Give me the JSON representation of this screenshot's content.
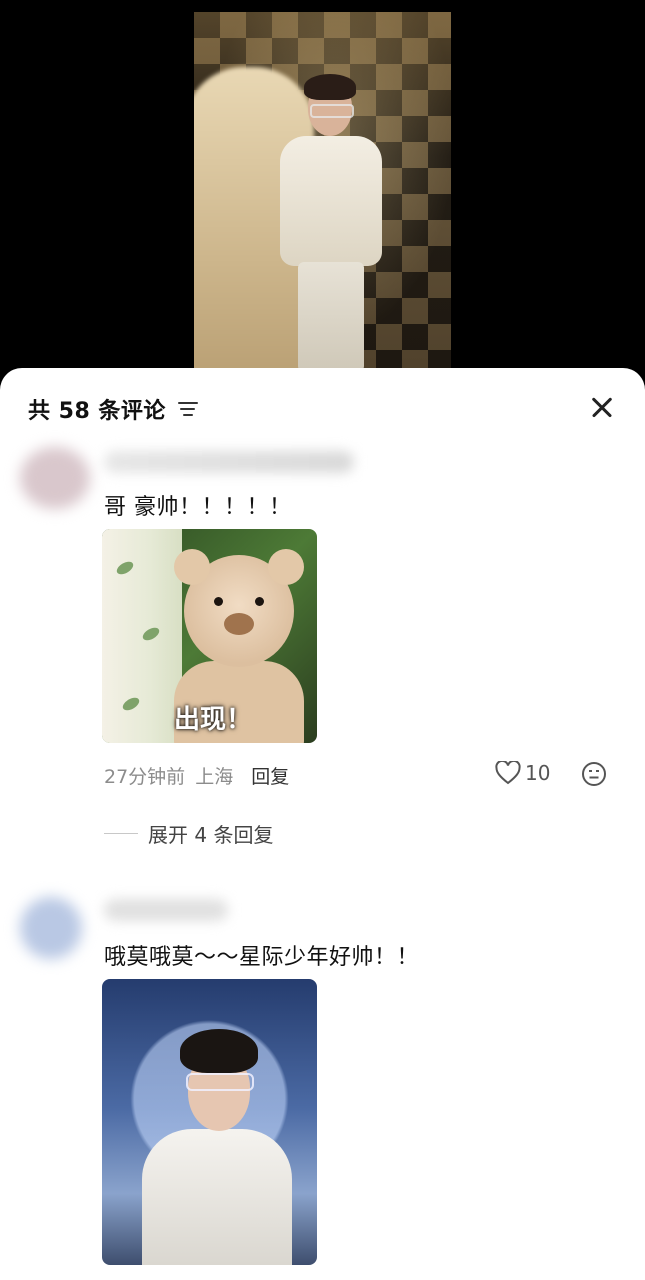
{
  "comments_panel": {
    "title": "共 58 条评论",
    "sort_icon": "filter-lines-icon",
    "close_icon": "close-icon"
  },
  "comments": [
    {
      "text": "哥 豪帅！！！！！",
      "sticker_caption": "出现！",
      "time": "27分钟前",
      "location": "上海",
      "reply_label": "回复",
      "like_count": "10",
      "expand_replies": "展开 4 条回复"
    },
    {
      "text": "哦莫哦莫～～星际少年好帅！！"
    }
  ],
  "icons": {
    "like": "heart-outline-icon",
    "emoji": "emoji-face-icon"
  },
  "colors": {
    "sheet_bg": "#ffffff",
    "backdrop": "#000000",
    "meta_text": "#8c8c8c"
  }
}
